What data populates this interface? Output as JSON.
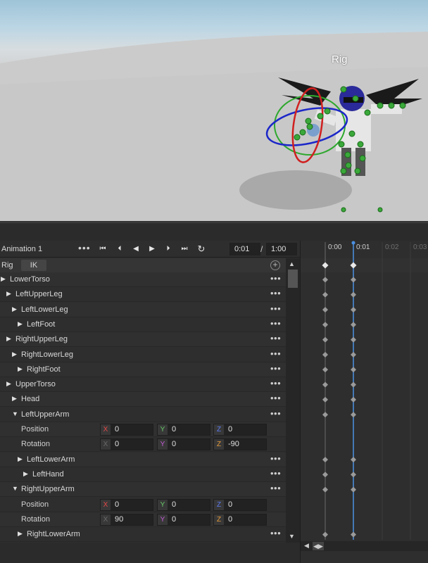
{
  "viewport": {
    "rig_label": "Rig"
  },
  "toolbar": {
    "animation_name": "Animation 1",
    "more": "•••",
    "buttons": {
      "first": "⏮",
      "prev_key": "⏴",
      "play_back": "◀",
      "play": "▶",
      "next_key": "⏵",
      "last": "⏭",
      "loop": "↻"
    },
    "current_time": "0:01",
    "slash": "/",
    "end_time": "1:00"
  },
  "rig_row": {
    "label": "Rig",
    "ik_label": "IK",
    "add": "+"
  },
  "tracks": [
    {
      "name": "LowerTorso",
      "type": "bone",
      "expanded": false
    },
    {
      "name": "LeftUpperLeg",
      "type": "bone",
      "expanded": false
    },
    {
      "name": "LeftLowerLeg",
      "type": "bone",
      "expanded": false
    },
    {
      "name": "LeftFoot",
      "type": "bone",
      "expanded": false
    },
    {
      "name": "RightUpperLeg",
      "type": "bone",
      "expanded": false
    },
    {
      "name": "RightLowerLeg",
      "type": "bone",
      "expanded": false
    },
    {
      "name": "RightFoot",
      "type": "bone",
      "expanded": false
    },
    {
      "name": "UpperTorso",
      "type": "bone",
      "expanded": false
    },
    {
      "name": "Head",
      "type": "bone",
      "expanded": false
    },
    {
      "name": "LeftUpperArm",
      "type": "bone",
      "expanded": true
    },
    {
      "name": "Position",
      "type": "prop",
      "x": "0",
      "y": "0",
      "z": "0"
    },
    {
      "name": "Rotation",
      "type": "prop",
      "x": "0",
      "y": "0",
      "z": "-90"
    },
    {
      "name": "LeftLowerArm",
      "type": "bone",
      "expanded": false
    },
    {
      "name": "LeftHand",
      "type": "bone",
      "expanded": false
    },
    {
      "name": "RightUpperArm",
      "type": "bone",
      "expanded": true
    },
    {
      "name": "Position",
      "type": "prop",
      "x": "0",
      "y": "0",
      "z": "0"
    },
    {
      "name": "Rotation",
      "type": "prop",
      "x": "90",
      "y": "0",
      "z": "0"
    },
    {
      "name": "RightLowerArm",
      "type": "bone",
      "expanded": false
    }
  ],
  "axis_labels": {
    "x": "X",
    "y": "Y",
    "z": "Z"
  },
  "row_menu": "•••",
  "timeline": {
    "ticks": [
      "0:00",
      "0:01",
      "0:02",
      "0:03"
    ],
    "playhead_tick": "0:01",
    "colors": {
      "playhead": "#4a90e2",
      "keyframe": "#9a9a9a",
      "keyframe_selected": "#e8e8e8"
    }
  }
}
